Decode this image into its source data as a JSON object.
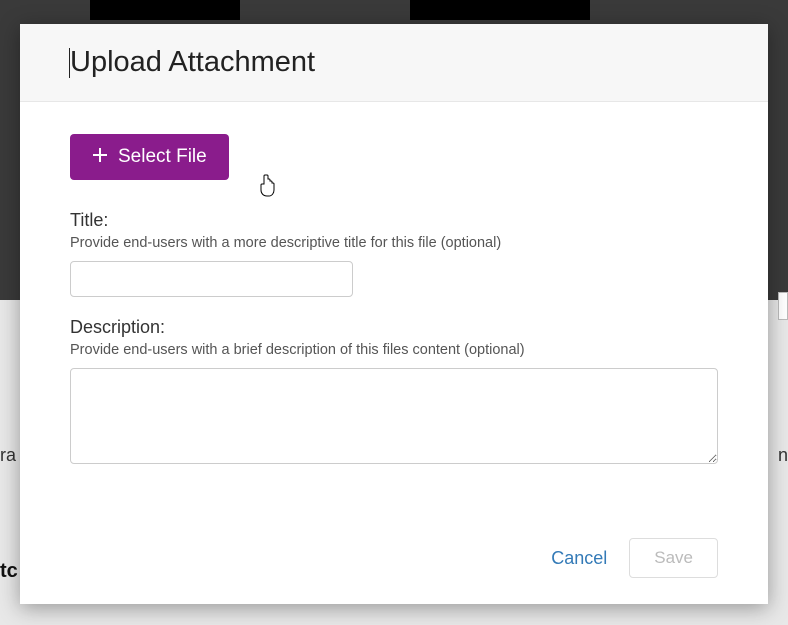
{
  "modal": {
    "title": "Upload Attachment",
    "selectFile": {
      "label": "Select File"
    },
    "titleField": {
      "label": "Title:",
      "help": "Provide end-users with a more descriptive title for this file (optional)",
      "value": ""
    },
    "descriptionField": {
      "label": "Description:",
      "help": "Provide end-users with a brief description of this files content (optional)",
      "value": ""
    },
    "footer": {
      "cancel": "Cancel",
      "save": "Save"
    }
  },
  "background": {
    "leftText": "ra",
    "rightText": "n",
    "boldLeft": "tc"
  }
}
